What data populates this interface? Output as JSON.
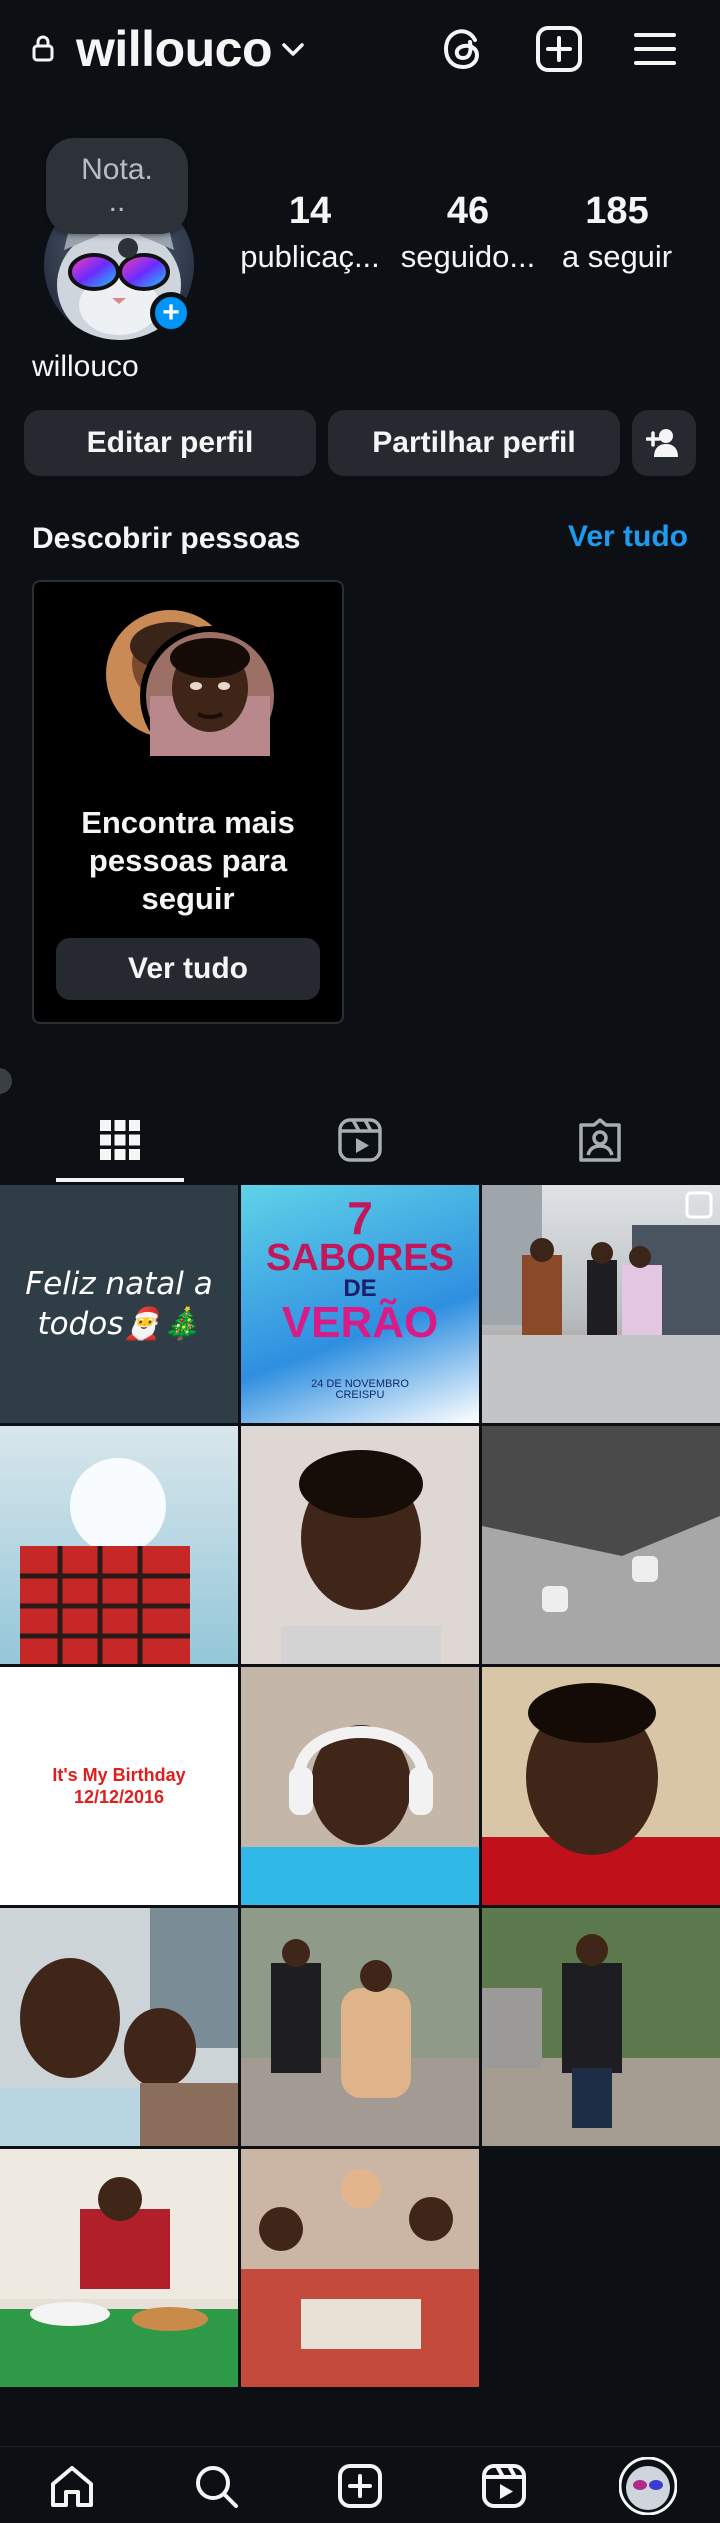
{
  "header": {
    "username": "willouco",
    "icons": [
      "lock-icon",
      "chevron-down-icon",
      "threads-icon",
      "add-post-icon",
      "menu-icon"
    ]
  },
  "profile": {
    "note_line1": "Nota.",
    "note_line2": "..",
    "add_story_symbol": "+",
    "name": "willouco",
    "stats": [
      {
        "value": "14",
        "label": "publicaç..."
      },
      {
        "value": "46",
        "label": "seguido..."
      },
      {
        "value": "185",
        "label": "a seguir"
      }
    ]
  },
  "actions": {
    "edit_profile": "Editar perfil",
    "share_profile": "Partilhar perfil"
  },
  "discover": {
    "title": "Descobrir pessoas",
    "see_all": "Ver tudo",
    "card_text": "Encontra mais pessoas para seguir",
    "card_button": "Ver tudo"
  },
  "tabs": [
    {
      "name": "grid",
      "icon": "grid-icon",
      "active": true
    },
    {
      "name": "reels",
      "icon": "reels-icon",
      "active": false
    },
    {
      "name": "tagged",
      "icon": "tagged-icon",
      "active": false
    }
  ],
  "posts": [
    {
      "caption": "Feliz natal a todos🎅🎄"
    },
    {
      "line1": "7",
      "line2": "SABORES",
      "line3": "DE",
      "line4": "VERÃO",
      "footer": "24 DE NOVEMBRO",
      "footer2": "CREISPU"
    },
    {
      "caption": ""
    },
    {
      "caption": ""
    },
    {
      "caption": ""
    },
    {
      "caption": ""
    },
    {
      "line1": "It's My Birthday",
      "line2": "12/12/2016"
    },
    {
      "caption": ""
    },
    {
      "caption": ""
    },
    {
      "caption": ""
    },
    {
      "caption": ""
    },
    {
      "caption": ""
    },
    {
      "caption": ""
    },
    {
      "caption": ""
    }
  ],
  "bottom_nav": [
    "home-icon",
    "search-icon",
    "create-icon",
    "reels-icon",
    "profile-avatar"
  ],
  "colors": {
    "background": "#0c1014",
    "button": "#262a30",
    "accent": "#0095f6",
    "link": "#1e9bf0"
  }
}
